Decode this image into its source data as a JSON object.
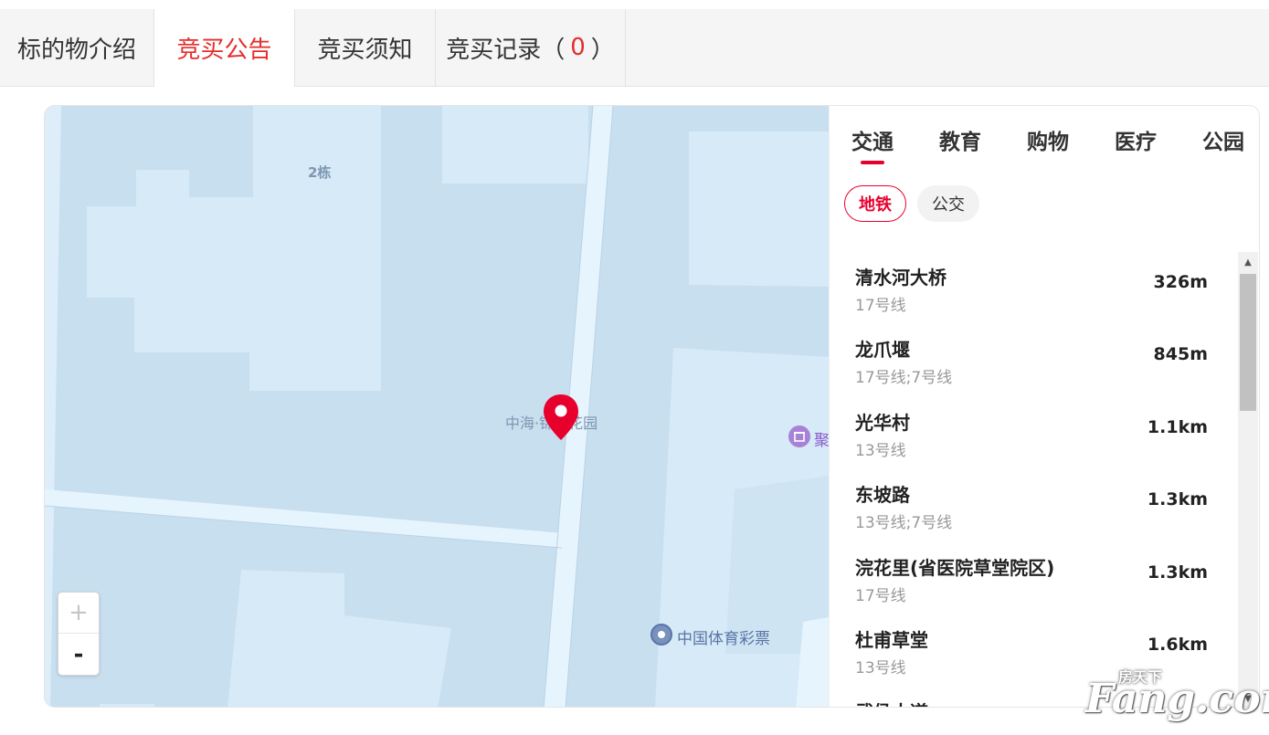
{
  "tabs": [
    {
      "label": "标的物介绍",
      "active": false
    },
    {
      "label": "竞买公告",
      "active": true
    },
    {
      "label": "竞买须知",
      "active": false
    },
    {
      "label": "竞买记录（",
      "count": "0",
      "suffix": "）",
      "active": false
    }
  ],
  "map": {
    "labels": {
      "building": "2栋",
      "community": "中海·锦蓉花园",
      "poi_lottery": "中国体育彩票",
      "poi_partial": "聚"
    },
    "zoom_in": "+",
    "zoom_out": "-",
    "colors": {
      "marker": "#e8002d",
      "block": "#c8dff0",
      "block_light": "#d6eaf7",
      "road": "#e6f4fd"
    }
  },
  "panel": {
    "categories": [
      "交通",
      "教育",
      "购物",
      "医疗",
      "公园"
    ],
    "active_category": "交通",
    "sub_tabs": [
      "地铁",
      "公交"
    ],
    "active_sub_tab": "地铁",
    "stations": [
      {
        "name": "清水河大桥",
        "lines": "17号线",
        "distance": "326m"
      },
      {
        "name": "龙爪堰",
        "lines": "17号线;7号线",
        "distance": "845m"
      },
      {
        "name": "光华村",
        "lines": "13号线",
        "distance": "1.1km"
      },
      {
        "name": "东坡路",
        "lines": "13号线;7号线",
        "distance": "1.3km"
      },
      {
        "name": "浣花里(省医院草堂院区)",
        "lines": "17号线",
        "distance": "1.3km"
      },
      {
        "name": "杜甫草堂",
        "lines": "13号线",
        "distance": "1.6km"
      },
      {
        "name": "武侯大道",
        "lines": "",
        "distance": ""
      }
    ],
    "accent_color": "#e8002d"
  },
  "watermark": {
    "cn": "房天下",
    "en": "Fang.com"
  }
}
